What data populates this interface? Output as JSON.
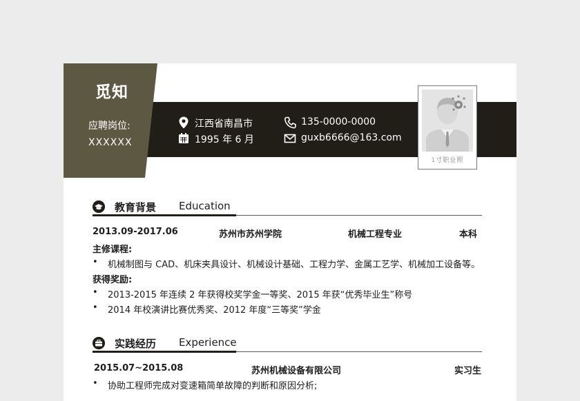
{
  "header": {
    "name": "觅知",
    "position_label": "应聘岗位:",
    "position_value": "XXXXXX",
    "location": "江西省南昌市",
    "birth": "1995 年 6 月",
    "phone": "135-0000-0000",
    "email": "guxb6666@163.com",
    "photo_caption": "1寸职业照"
  },
  "education": {
    "title_cn": "教育背景",
    "title_en": "Education",
    "period": "2013.09-2017.06",
    "school": "苏州市苏州学院",
    "major": "机械工程专业",
    "degree": "本科",
    "courses_label": "主修课程:",
    "courses": [
      "机械制图与 CAD、机床夹具设计、机械设计基础、工程力学、金属工艺学、机械加工设备等。"
    ],
    "awards_label": "获得奖励:",
    "awards": [
      "2013-2015 年连续 2 年获得校奖学金一等奖、2015 年获“优秀毕业生”称号",
      "2014 年校演讲比赛优秀奖、2012 年度“三等奖”学金"
    ]
  },
  "experience": {
    "title_cn": "实践经历",
    "title_en": "Experience",
    "period": "2015.07~2015.08",
    "company": "苏州机械设备有限公司",
    "role": "实习生",
    "items": [
      "协助工程师完成对变速箱简单故障的判断和原因分析;"
    ]
  },
  "bullet_char": "•",
  "colors": {
    "band": "#211e17",
    "accent": "#5c5842",
    "page_bg": "#ececec"
  },
  "icons": [
    "location-icon",
    "calendar-icon",
    "phone-icon",
    "mail-icon",
    "graduation-cap-icon",
    "briefcase-icon"
  ]
}
